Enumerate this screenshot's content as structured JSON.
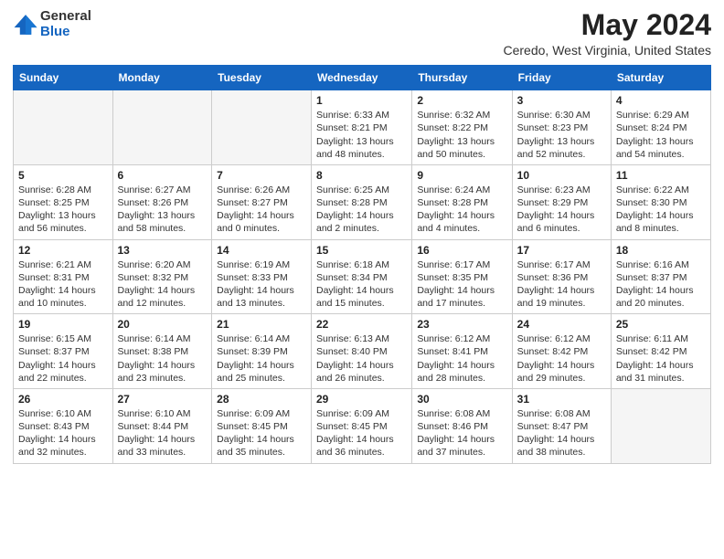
{
  "header": {
    "logo_general": "General",
    "logo_blue": "Blue",
    "month_year": "May 2024",
    "location": "Ceredo, West Virginia, United States"
  },
  "weekdays": [
    "Sunday",
    "Monday",
    "Tuesday",
    "Wednesday",
    "Thursday",
    "Friday",
    "Saturday"
  ],
  "weeks": [
    [
      {
        "day": "",
        "info": ""
      },
      {
        "day": "",
        "info": ""
      },
      {
        "day": "",
        "info": ""
      },
      {
        "day": "1",
        "info": "Sunrise: 6:33 AM\nSunset: 8:21 PM\nDaylight: 13 hours\nand 48 minutes."
      },
      {
        "day": "2",
        "info": "Sunrise: 6:32 AM\nSunset: 8:22 PM\nDaylight: 13 hours\nand 50 minutes."
      },
      {
        "day": "3",
        "info": "Sunrise: 6:30 AM\nSunset: 8:23 PM\nDaylight: 13 hours\nand 52 minutes."
      },
      {
        "day": "4",
        "info": "Sunrise: 6:29 AM\nSunset: 8:24 PM\nDaylight: 13 hours\nand 54 minutes."
      }
    ],
    [
      {
        "day": "5",
        "info": "Sunrise: 6:28 AM\nSunset: 8:25 PM\nDaylight: 13 hours\nand 56 minutes."
      },
      {
        "day": "6",
        "info": "Sunrise: 6:27 AM\nSunset: 8:26 PM\nDaylight: 13 hours\nand 58 minutes."
      },
      {
        "day": "7",
        "info": "Sunrise: 6:26 AM\nSunset: 8:27 PM\nDaylight: 14 hours\nand 0 minutes."
      },
      {
        "day": "8",
        "info": "Sunrise: 6:25 AM\nSunset: 8:28 PM\nDaylight: 14 hours\nand 2 minutes."
      },
      {
        "day": "9",
        "info": "Sunrise: 6:24 AM\nSunset: 8:28 PM\nDaylight: 14 hours\nand 4 minutes."
      },
      {
        "day": "10",
        "info": "Sunrise: 6:23 AM\nSunset: 8:29 PM\nDaylight: 14 hours\nand 6 minutes."
      },
      {
        "day": "11",
        "info": "Sunrise: 6:22 AM\nSunset: 8:30 PM\nDaylight: 14 hours\nand 8 minutes."
      }
    ],
    [
      {
        "day": "12",
        "info": "Sunrise: 6:21 AM\nSunset: 8:31 PM\nDaylight: 14 hours\nand 10 minutes."
      },
      {
        "day": "13",
        "info": "Sunrise: 6:20 AM\nSunset: 8:32 PM\nDaylight: 14 hours\nand 12 minutes."
      },
      {
        "day": "14",
        "info": "Sunrise: 6:19 AM\nSunset: 8:33 PM\nDaylight: 14 hours\nand 13 minutes."
      },
      {
        "day": "15",
        "info": "Sunrise: 6:18 AM\nSunset: 8:34 PM\nDaylight: 14 hours\nand 15 minutes."
      },
      {
        "day": "16",
        "info": "Sunrise: 6:17 AM\nSunset: 8:35 PM\nDaylight: 14 hours\nand 17 minutes."
      },
      {
        "day": "17",
        "info": "Sunrise: 6:17 AM\nSunset: 8:36 PM\nDaylight: 14 hours\nand 19 minutes."
      },
      {
        "day": "18",
        "info": "Sunrise: 6:16 AM\nSunset: 8:37 PM\nDaylight: 14 hours\nand 20 minutes."
      }
    ],
    [
      {
        "day": "19",
        "info": "Sunrise: 6:15 AM\nSunset: 8:37 PM\nDaylight: 14 hours\nand 22 minutes."
      },
      {
        "day": "20",
        "info": "Sunrise: 6:14 AM\nSunset: 8:38 PM\nDaylight: 14 hours\nand 23 minutes."
      },
      {
        "day": "21",
        "info": "Sunrise: 6:14 AM\nSunset: 8:39 PM\nDaylight: 14 hours\nand 25 minutes."
      },
      {
        "day": "22",
        "info": "Sunrise: 6:13 AM\nSunset: 8:40 PM\nDaylight: 14 hours\nand 26 minutes."
      },
      {
        "day": "23",
        "info": "Sunrise: 6:12 AM\nSunset: 8:41 PM\nDaylight: 14 hours\nand 28 minutes."
      },
      {
        "day": "24",
        "info": "Sunrise: 6:12 AM\nSunset: 8:42 PM\nDaylight: 14 hours\nand 29 minutes."
      },
      {
        "day": "25",
        "info": "Sunrise: 6:11 AM\nSunset: 8:42 PM\nDaylight: 14 hours\nand 31 minutes."
      }
    ],
    [
      {
        "day": "26",
        "info": "Sunrise: 6:10 AM\nSunset: 8:43 PM\nDaylight: 14 hours\nand 32 minutes."
      },
      {
        "day": "27",
        "info": "Sunrise: 6:10 AM\nSunset: 8:44 PM\nDaylight: 14 hours\nand 33 minutes."
      },
      {
        "day": "28",
        "info": "Sunrise: 6:09 AM\nSunset: 8:45 PM\nDaylight: 14 hours\nand 35 minutes."
      },
      {
        "day": "29",
        "info": "Sunrise: 6:09 AM\nSunset: 8:45 PM\nDaylight: 14 hours\nand 36 minutes."
      },
      {
        "day": "30",
        "info": "Sunrise: 6:08 AM\nSunset: 8:46 PM\nDaylight: 14 hours\nand 37 minutes."
      },
      {
        "day": "31",
        "info": "Sunrise: 6:08 AM\nSunset: 8:47 PM\nDaylight: 14 hours\nand 38 minutes."
      },
      {
        "day": "",
        "info": ""
      }
    ]
  ]
}
